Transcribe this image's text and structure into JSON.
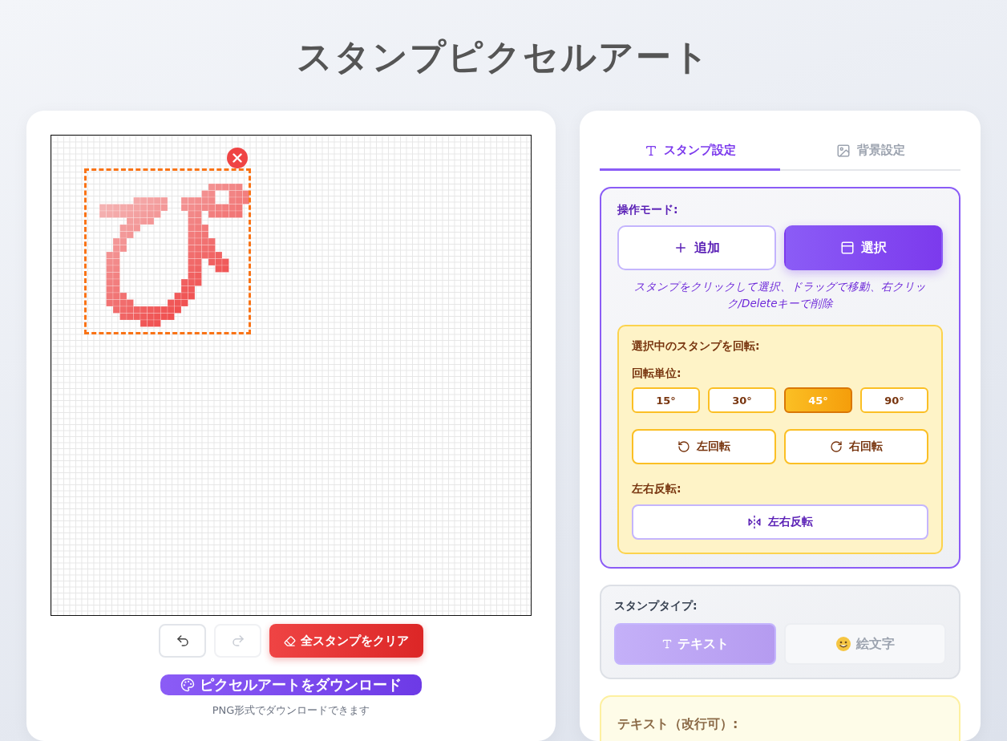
{
  "title": "スタンプピクセルアート",
  "canvas": {
    "stamp": {
      "selected": true
    }
  },
  "history": [
    {
      "kind": "undo",
      "disabled": false
    },
    {
      "kind": "redo",
      "disabled": true
    }
  ],
  "clear_button": "全スタンプをクリア",
  "download_button": "ピクセルアートをダウンロード",
  "download_note": "PNG形式でダウンロードできます",
  "tabs": [
    {
      "label": "スタンプ設定",
      "selected": true
    },
    {
      "label": "背景設定",
      "selected": false
    }
  ],
  "mode": {
    "label": "操作モード:",
    "options": [
      {
        "label": "追加",
        "selected": false
      },
      {
        "label": "選択",
        "selected": true
      }
    ],
    "hint": "スタンプをクリックして選択、ドラッグで移動、右クリック/Deleteキーで削除"
  },
  "rotate": {
    "title": "選択中のスタンプを回転:",
    "unit_label": "回転単位:",
    "units": [
      {
        "label": "15°",
        "selected": false
      },
      {
        "label": "30°",
        "selected": false
      },
      {
        "label": "45°",
        "selected": true
      },
      {
        "label": "90°",
        "selected": false
      }
    ],
    "buttons": [
      "左回転",
      "右回転"
    ],
    "flip_label": "左右反転:",
    "flip_button": "左右反転"
  },
  "stamp_type": {
    "label": "スタンプタイプ:",
    "options": [
      {
        "label": "テキスト",
        "selected": true
      },
      {
        "label": "絵文字",
        "selected": false
      }
    ]
  },
  "text_field": {
    "label": "テキスト（改行可）:"
  }
}
